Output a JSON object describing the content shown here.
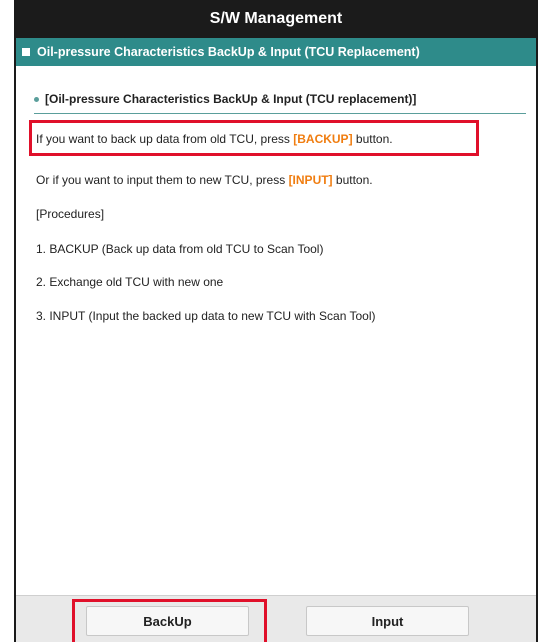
{
  "header": {
    "title": "S/W Management"
  },
  "subheader": {
    "title": "Oil-pressure Characteristics BackUp & Input (TCU Replacement)",
    "icon": "square-icon"
  },
  "section": {
    "heading": "[Oil-pressure Characteristics BackUp & Input (TCU replacement)]",
    "line1": {
      "pre": "If you want to back up data from old TCU, press ",
      "hl": "[BACKUP]",
      "post": " button."
    },
    "line2": {
      "pre": "Or if you want to input them to new TCU, press ",
      "hl": "[INPUT]",
      "post": " button."
    },
    "procedures_label": "[Procedures]",
    "steps": [
      "1. BACKUP (Back up data from old TCU to Scan Tool)",
      "2. Exchange old TCU with new one",
      "3. INPUT (Input the backed up data to new TCU with Scan Tool)"
    ]
  },
  "buttons": {
    "backup": "BackUp",
    "input": "Input"
  },
  "colors": {
    "titlebar": "#1b1b1b",
    "subheader": "#2e8b8a",
    "highlight": "#f07d10",
    "annotation": "#e0102a"
  }
}
